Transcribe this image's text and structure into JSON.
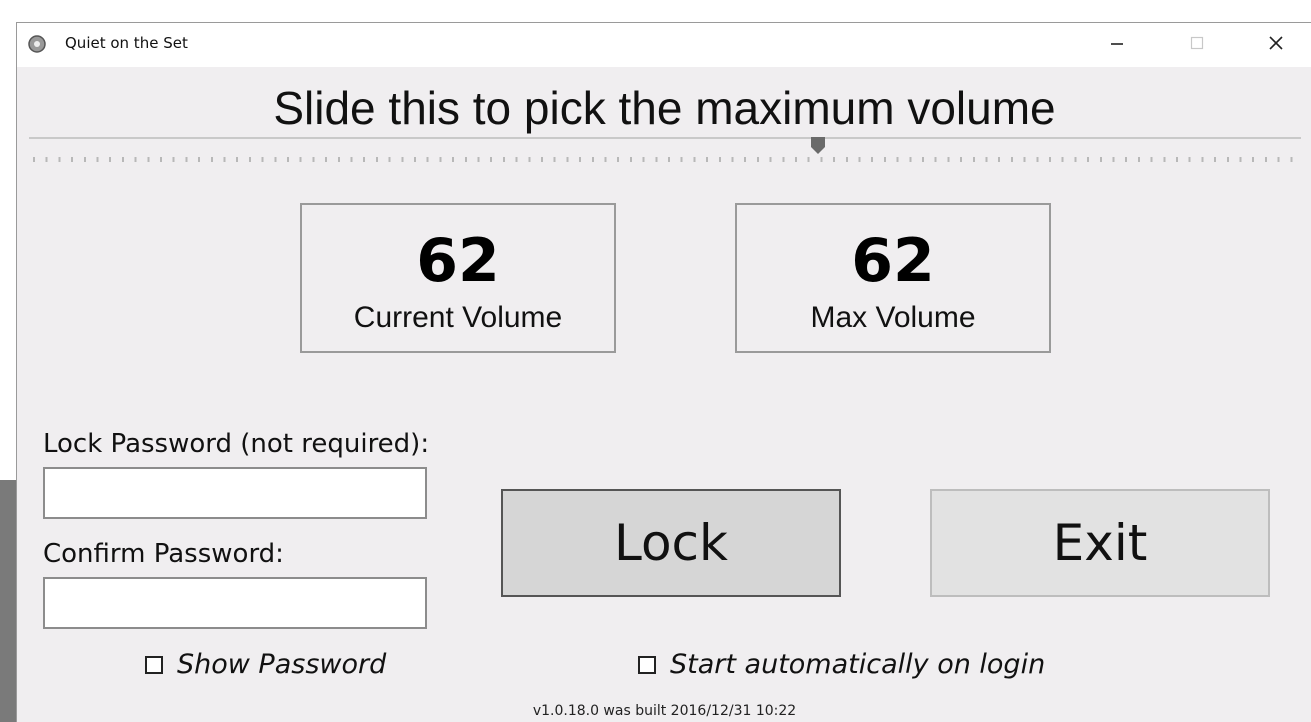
{
  "window": {
    "title": "Quiet on the Set",
    "icon": "app-icon",
    "controls": {
      "minimize": "minimize-icon",
      "maximize": "maximize-icon",
      "close": "close-icon"
    }
  },
  "slider": {
    "title": "Slide this to pick the maximum volume",
    "value": 62,
    "min": 0,
    "max": 100
  },
  "volume": {
    "current_value": "62",
    "current_label": "Current Volume",
    "max_value": "62",
    "max_label": "Max Volume"
  },
  "password": {
    "lock_label": "Lock Password (not required):",
    "lock_value": "",
    "confirm_label": "Confirm Password:",
    "confirm_value": ""
  },
  "buttons": {
    "lock": "Lock",
    "exit": "Exit"
  },
  "options": {
    "show_password_label": "Show Password",
    "show_password_checked": false,
    "autostart_label": "Start automatically on login",
    "autostart_checked": false
  },
  "footer": {
    "build_info": "v1.0.18.0 was built 2016/12/31 10:22"
  }
}
